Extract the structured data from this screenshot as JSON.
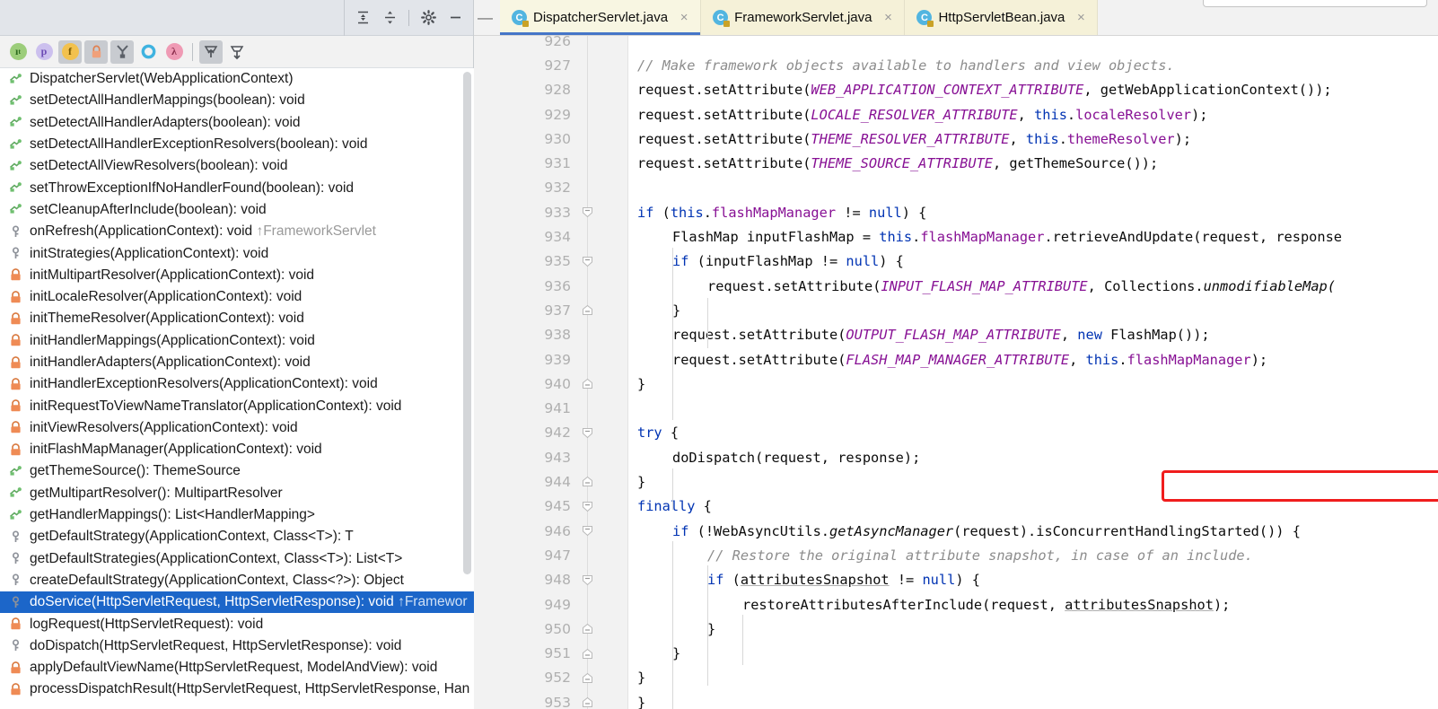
{
  "structure_panel": {
    "header_buttons": [
      {
        "name": "expand-all-icon",
        "label": "Expand All"
      },
      {
        "name": "collapse-all-icon",
        "label": "Collapse All"
      },
      {
        "name": "settings-gear-icon",
        "label": "Settings"
      },
      {
        "name": "minimize-icon",
        "label": "Hide"
      }
    ],
    "toolbar_buttons": [
      {
        "name": "sort-alphabetically-icon",
        "glyph": "ı",
        "sup": "t",
        "bg": "#9ccd7a",
        "fg": "#2d6b1f",
        "pressed": false
      },
      {
        "name": "show-properties-icon",
        "glyph": "p",
        "bg": "#ccc0ee",
        "fg": "#6d4bb5",
        "pressed": false
      },
      {
        "name": "show-fields-icon",
        "glyph": "f",
        "bg": "#f2c14e",
        "fg": "#7a5a00",
        "pressed": true
      },
      {
        "name": "show-non-public-icon",
        "glyph": "🔒",
        "bg": "#f0a07a",
        "fg": "#ffffff",
        "pressed": true
      },
      {
        "name": "show-inherited-icon",
        "glyph": "Y",
        "bg": "#8d9199",
        "fg": "#4a4d53",
        "pressed": true
      },
      {
        "name": "show-anonymous-classes-icon",
        "glyph": "O",
        "bg": "#67c3e8",
        "fg": "#ffffff",
        "pressed": false
      },
      {
        "name": "show-lambdas-icon",
        "glyph": "λ",
        "bg": "#ef9ab4",
        "fg": "#8e2f4e",
        "pressed": false
      },
      {
        "name": "autoscroll-to-source-icon",
        "glyph": "↑",
        "pressed": true
      },
      {
        "name": "autoscroll-from-source-icon",
        "glyph": "↓",
        "pressed": false
      }
    ],
    "items": [
      {
        "icon": "method-public",
        "label": "DispatcherServlet(WebApplicationContext)",
        "inherit": "",
        "selected": false
      },
      {
        "icon": "method-public",
        "label": "setDetectAllHandlerMappings(boolean): void",
        "inherit": "",
        "selected": false
      },
      {
        "icon": "method-public",
        "label": "setDetectAllHandlerAdapters(boolean): void",
        "inherit": "",
        "selected": false
      },
      {
        "icon": "method-public",
        "label": "setDetectAllHandlerExceptionResolvers(boolean): void",
        "inherit": "",
        "selected": false
      },
      {
        "icon": "method-public",
        "label": "setDetectAllViewResolvers(boolean): void",
        "inherit": "",
        "selected": false
      },
      {
        "icon": "method-public",
        "label": "setThrowExceptionIfNoHandlerFound(boolean): void",
        "inherit": "",
        "selected": false
      },
      {
        "icon": "method-public",
        "label": "setCleanupAfterInclude(boolean): void",
        "inherit": "",
        "selected": false
      },
      {
        "icon": "method-protected",
        "label": "onRefresh(ApplicationContext): void ",
        "inherit": "↑FrameworkServlet",
        "selected": false
      },
      {
        "icon": "method-protected",
        "label": "initStrategies(ApplicationContext): void",
        "inherit": "",
        "selected": false
      },
      {
        "icon": "method-private",
        "label": "initMultipartResolver(ApplicationContext): void",
        "inherit": "",
        "selected": false
      },
      {
        "icon": "method-private",
        "label": "initLocaleResolver(ApplicationContext): void",
        "inherit": "",
        "selected": false
      },
      {
        "icon": "method-private",
        "label": "initThemeResolver(ApplicationContext): void",
        "inherit": "",
        "selected": false
      },
      {
        "icon": "method-private",
        "label": "initHandlerMappings(ApplicationContext): void",
        "inherit": "",
        "selected": false
      },
      {
        "icon": "method-private",
        "label": "initHandlerAdapters(ApplicationContext): void",
        "inherit": "",
        "selected": false
      },
      {
        "icon": "method-private",
        "label": "initHandlerExceptionResolvers(ApplicationContext): void",
        "inherit": "",
        "selected": false
      },
      {
        "icon": "method-private",
        "label": "initRequestToViewNameTranslator(ApplicationContext): void",
        "inherit": "",
        "selected": false
      },
      {
        "icon": "method-private",
        "label": "initViewResolvers(ApplicationContext): void",
        "inherit": "",
        "selected": false
      },
      {
        "icon": "method-private",
        "label": "initFlashMapManager(ApplicationContext): void",
        "inherit": "",
        "selected": false
      },
      {
        "icon": "method-public",
        "label": "getThemeSource(): ThemeSource",
        "inherit": "",
        "selected": false
      },
      {
        "icon": "method-public",
        "label": "getMultipartResolver(): MultipartResolver",
        "inherit": "",
        "selected": false
      },
      {
        "icon": "method-public",
        "label": "getHandlerMappings(): List<HandlerMapping>",
        "inherit": "",
        "selected": false
      },
      {
        "icon": "method-protected",
        "label": "getDefaultStrategy(ApplicationContext, Class<T>): T",
        "inherit": "",
        "selected": false
      },
      {
        "icon": "method-protected",
        "label": "getDefaultStrategies(ApplicationContext, Class<T>): List<T>",
        "inherit": "",
        "selected": false
      },
      {
        "icon": "method-protected",
        "label": "createDefaultStrategy(ApplicationContext, Class<?>): Object",
        "inherit": "",
        "selected": false
      },
      {
        "icon": "method-protected",
        "label": "doService(HttpServletRequest, HttpServletResponse): void ",
        "inherit": "↑Framewor",
        "selected": true
      },
      {
        "icon": "method-private",
        "label": "logRequest(HttpServletRequest): void",
        "inherit": "",
        "selected": false
      },
      {
        "icon": "method-protected",
        "label": "doDispatch(HttpServletRequest, HttpServletResponse): void",
        "inherit": "",
        "selected": false
      },
      {
        "icon": "method-private",
        "label": "applyDefaultViewName(HttpServletRequest, ModelAndView): void",
        "inherit": "",
        "selected": false
      },
      {
        "icon": "method-private",
        "label": "processDispatchResult(HttpServletRequest, HttpServletResponse, Han",
        "inherit": "",
        "selected": false
      }
    ]
  },
  "editor": {
    "tabs": [
      {
        "label": "DispatcherServlet.java",
        "active": true,
        "close": "×"
      },
      {
        "label": "FrameworkServlet.java",
        "active": false,
        "close": "×"
      },
      {
        "label": "HttpServletBean.java",
        "active": false,
        "close": "×"
      }
    ],
    "first_line_number": 926,
    "lines": [
      {
        "n": 926,
        "indent": 0,
        "fold": "",
        "segs": []
      },
      {
        "n": 927,
        "indent": 2,
        "fold": "",
        "segs": [
          {
            "t": "// Make framework objects available to handlers and view objects.",
            "c": "cmt"
          }
        ]
      },
      {
        "n": 928,
        "indent": 2,
        "fold": "",
        "segs": [
          {
            "t": "request.setAttribute(",
            "c": ""
          },
          {
            "t": "WEB_APPLICATION_CONTEXT_ATTRIBUTE",
            "c": "stat"
          },
          {
            "t": ", getWebApplicationContext());",
            "c": ""
          }
        ]
      },
      {
        "n": 929,
        "indent": 2,
        "fold": "",
        "segs": [
          {
            "t": "request.setAttribute(",
            "c": ""
          },
          {
            "t": "LOCALE_RESOLVER_ATTRIBUTE",
            "c": "stat"
          },
          {
            "t": ", ",
            "c": ""
          },
          {
            "t": "this",
            "c": "kw"
          },
          {
            "t": ".",
            "c": ""
          },
          {
            "t": "localeResolver",
            "c": "fld"
          },
          {
            "t": ");",
            "c": ""
          }
        ]
      },
      {
        "n": 930,
        "indent": 2,
        "fold": "",
        "segs": [
          {
            "t": "request.setAttribute(",
            "c": ""
          },
          {
            "t": "THEME_RESOLVER_ATTRIBUTE",
            "c": "stat"
          },
          {
            "t": ", ",
            "c": ""
          },
          {
            "t": "this",
            "c": "kw"
          },
          {
            "t": ".",
            "c": ""
          },
          {
            "t": "themeResolver",
            "c": "fld"
          },
          {
            "t": ");",
            "c": ""
          }
        ]
      },
      {
        "n": 931,
        "indent": 2,
        "fold": "",
        "segs": [
          {
            "t": "request.setAttribute(",
            "c": ""
          },
          {
            "t": "THEME_SOURCE_ATTRIBUTE",
            "c": "stat"
          },
          {
            "t": ", getThemeSource());",
            "c": ""
          }
        ]
      },
      {
        "n": 932,
        "indent": 0,
        "fold": "",
        "segs": []
      },
      {
        "n": 933,
        "indent": 2,
        "fold": "open",
        "segs": [
          {
            "t": "if",
            "c": "kw"
          },
          {
            "t": " (",
            "c": ""
          },
          {
            "t": "this",
            "c": "kw"
          },
          {
            "t": ".",
            "c": ""
          },
          {
            "t": "flashMapManager",
            "c": "fld"
          },
          {
            "t": " != ",
            "c": ""
          },
          {
            "t": "null",
            "c": "kw"
          },
          {
            "t": ") {",
            "c": ""
          }
        ]
      },
      {
        "n": 934,
        "indent": 3,
        "fold": "",
        "segs": [
          {
            "t": "FlashMap inputFlashMap = ",
            "c": ""
          },
          {
            "t": "this",
            "c": "kw"
          },
          {
            "t": ".",
            "c": ""
          },
          {
            "t": "flashMapManager",
            "c": "fld"
          },
          {
            "t": ".retrieveAndUpdate(request, response",
            "c": ""
          }
        ]
      },
      {
        "n": 935,
        "indent": 3,
        "fold": "open",
        "segs": [
          {
            "t": "if",
            "c": "kw"
          },
          {
            "t": " (inputFlashMap != ",
            "c": ""
          },
          {
            "t": "null",
            "c": "kw"
          },
          {
            "t": ") {",
            "c": ""
          }
        ]
      },
      {
        "n": 936,
        "indent": 4,
        "fold": "",
        "segs": [
          {
            "t": "request.setAttribute(",
            "c": ""
          },
          {
            "t": "INPUT_FLASH_MAP_ATTRIBUTE",
            "c": "stat"
          },
          {
            "t": ", Collections.",
            "c": ""
          },
          {
            "t": "unmodifiableMap(",
            "c": "mth"
          }
        ]
      },
      {
        "n": 937,
        "indent": 3,
        "fold": "close",
        "segs": [
          {
            "t": "}",
            "c": ""
          }
        ]
      },
      {
        "n": 938,
        "indent": 3,
        "fold": "",
        "segs": [
          {
            "t": "request.setAttribute(",
            "c": ""
          },
          {
            "t": "OUTPUT_FLASH_MAP_ATTRIBUTE",
            "c": "stat"
          },
          {
            "t": ", ",
            "c": ""
          },
          {
            "t": "new",
            "c": "kw"
          },
          {
            "t": " FlashMap());",
            "c": ""
          }
        ]
      },
      {
        "n": 939,
        "indent": 3,
        "fold": "",
        "segs": [
          {
            "t": "request.setAttribute(",
            "c": ""
          },
          {
            "t": "FLASH_MAP_MANAGER_ATTRIBUTE",
            "c": "stat"
          },
          {
            "t": ", ",
            "c": ""
          },
          {
            "t": "this",
            "c": "kw"
          },
          {
            "t": ".",
            "c": ""
          },
          {
            "t": "flashMapManager",
            "c": "fld"
          },
          {
            "t": ");",
            "c": ""
          }
        ]
      },
      {
        "n": 940,
        "indent": 2,
        "fold": "close",
        "segs": [
          {
            "t": "}",
            "c": ""
          }
        ]
      },
      {
        "n": 941,
        "indent": 0,
        "fold": "",
        "segs": []
      },
      {
        "n": 942,
        "indent": 2,
        "fold": "open",
        "segs": [
          {
            "t": "try",
            "c": "kw"
          },
          {
            "t": " {",
            "c": ""
          }
        ]
      },
      {
        "n": 943,
        "indent": 3,
        "fold": "",
        "segs": [
          {
            "t": "doDispatch(request, response);",
            "c": ""
          }
        ]
      },
      {
        "n": 944,
        "indent": 2,
        "fold": "close",
        "segs": [
          {
            "t": "}",
            "c": ""
          }
        ]
      },
      {
        "n": 945,
        "indent": 2,
        "fold": "open",
        "segs": [
          {
            "t": "finally",
            "c": "kw"
          },
          {
            "t": " {",
            "c": ""
          }
        ]
      },
      {
        "n": 946,
        "indent": 3,
        "fold": "open",
        "segs": [
          {
            "t": "if",
            "c": "kw"
          },
          {
            "t": " (!WebAsyncUtils.",
            "c": ""
          },
          {
            "t": "getAsyncManager",
            "c": "mth"
          },
          {
            "t": "(request).isConcurrentHandlingStarted()) {",
            "c": ""
          }
        ]
      },
      {
        "n": 947,
        "indent": 4,
        "fold": "",
        "segs": [
          {
            "t": "// Restore the original attribute snapshot, in case of an include.",
            "c": "cmt"
          }
        ]
      },
      {
        "n": 948,
        "indent": 4,
        "fold": "open",
        "segs": [
          {
            "t": "if",
            "c": "kw"
          },
          {
            "t": " (",
            "c": ""
          },
          {
            "t": "attributesSnapshot",
            "c": "und"
          },
          {
            "t": " != ",
            "c": ""
          },
          {
            "t": "null",
            "c": "kw"
          },
          {
            "t": ") {",
            "c": ""
          }
        ]
      },
      {
        "n": 949,
        "indent": 5,
        "fold": "",
        "segs": [
          {
            "t": "restoreAttributesAfterInclude(request, ",
            "c": ""
          },
          {
            "t": "attributesSnapshot",
            "c": "und"
          },
          {
            "t": ");",
            "c": ""
          }
        ]
      },
      {
        "n": 950,
        "indent": 4,
        "fold": "close",
        "segs": [
          {
            "t": "}",
            "c": ""
          }
        ]
      },
      {
        "n": 951,
        "indent": 3,
        "fold": "close",
        "segs": [
          {
            "t": "}",
            "c": ""
          }
        ]
      },
      {
        "n": 952,
        "indent": 2,
        "fold": "close",
        "segs": [
          {
            "t": "}",
            "c": ""
          }
        ]
      },
      {
        "n": 953,
        "indent": 1,
        "fold": "close",
        "segs": [
          {
            "t": "}",
            "c": ""
          }
        ]
      }
    ],
    "annotation": {
      "name": "red-highlight-box",
      "target_line": 943,
      "target_text": "doDispatch(request, response);",
      "color": "#f01d1d"
    }
  }
}
